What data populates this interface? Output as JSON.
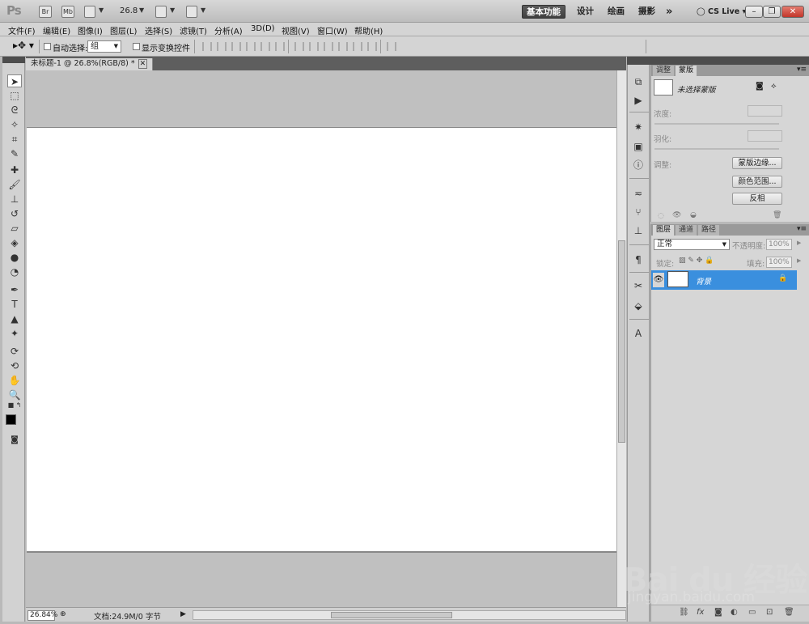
{
  "appbar": {
    "logo": "Ps",
    "bridge_label": "Br",
    "minibridge_label": "Mb",
    "zoom": "26.8",
    "workspaces": [
      "基本功能",
      "设计",
      "绘画",
      "摄影"
    ],
    "more": "»",
    "cslive": "CS Live"
  },
  "menu": [
    "文件(F)",
    "编辑(E)",
    "图像(I)",
    "图层(L)",
    "选择(S)",
    "滤镜(T)",
    "分析(A)",
    "3D(D)",
    "视图(V)",
    "窗口(W)",
    "帮助(H)"
  ],
  "options": {
    "auto_select_label": "自动选择:",
    "auto_select_value": "组",
    "show_transform_label": "显示变换控件"
  },
  "document": {
    "tab_title": "未标题-1 @ 26.8%(RGB/8) *",
    "zoom_status": "26.84%",
    "doc_status": "文档:24.9M/0 字节"
  },
  "masks_panel": {
    "tabs": [
      "调整",
      "蒙版"
    ],
    "title": "未选择蒙版",
    "density_label": "浓度:",
    "feather_label": "羽化:",
    "refine_label": "调整:",
    "btn_mask_edge": "蒙版边缘...",
    "btn_color_range": "颜色范围...",
    "btn_invert": "反相"
  },
  "layers_panel": {
    "tabs": [
      "图层",
      "通道",
      "路径"
    ],
    "blend_mode": "正常",
    "opacity_label": "不透明度:",
    "opacity_value": "100%",
    "lock_label": "锁定:",
    "fill_label": "填充:",
    "fill_value": "100%",
    "layers": [
      {
        "name": "背景",
        "visible": true,
        "locked": true
      }
    ]
  },
  "watermark": {
    "brand": "Bai du 经验",
    "url": "jingyan.baidu.com"
  },
  "colors": {
    "selection_blue": "#3a8fde",
    "foreground": "#000000",
    "background": "#ffffff"
  }
}
